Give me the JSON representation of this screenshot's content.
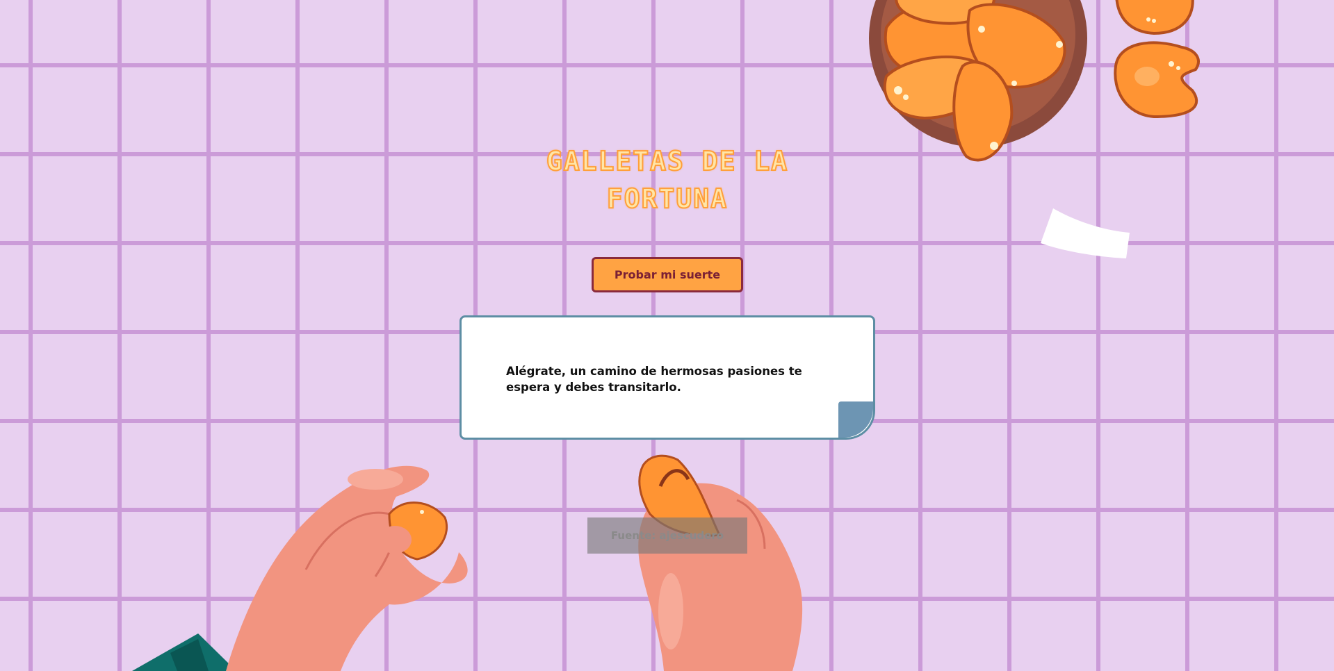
{
  "page": {
    "title": "GALLETAS DE LA FORTUNA"
  },
  "controls": {
    "luck_button_label": "Probar mi suerte"
  },
  "fortune": {
    "message": "Alégrate, un camino de hermosas pasiones te espera y debes transitarlo."
  },
  "footer": {
    "source_label": "Fuente: ajescudero"
  },
  "colors": {
    "background": "#e8d0f0",
    "grid_lines": "#cb9bd8",
    "title_fill": "#ffe6a8",
    "title_outline": "#ff9f3a",
    "button_fill": "#ffa343",
    "button_border": "#8a2a3c",
    "card_border": "#5d8ea4",
    "card_fold": "#6d95b3",
    "cookie": "#ff9433",
    "bowl": "#8b4a3c",
    "hand": "#f29480"
  }
}
